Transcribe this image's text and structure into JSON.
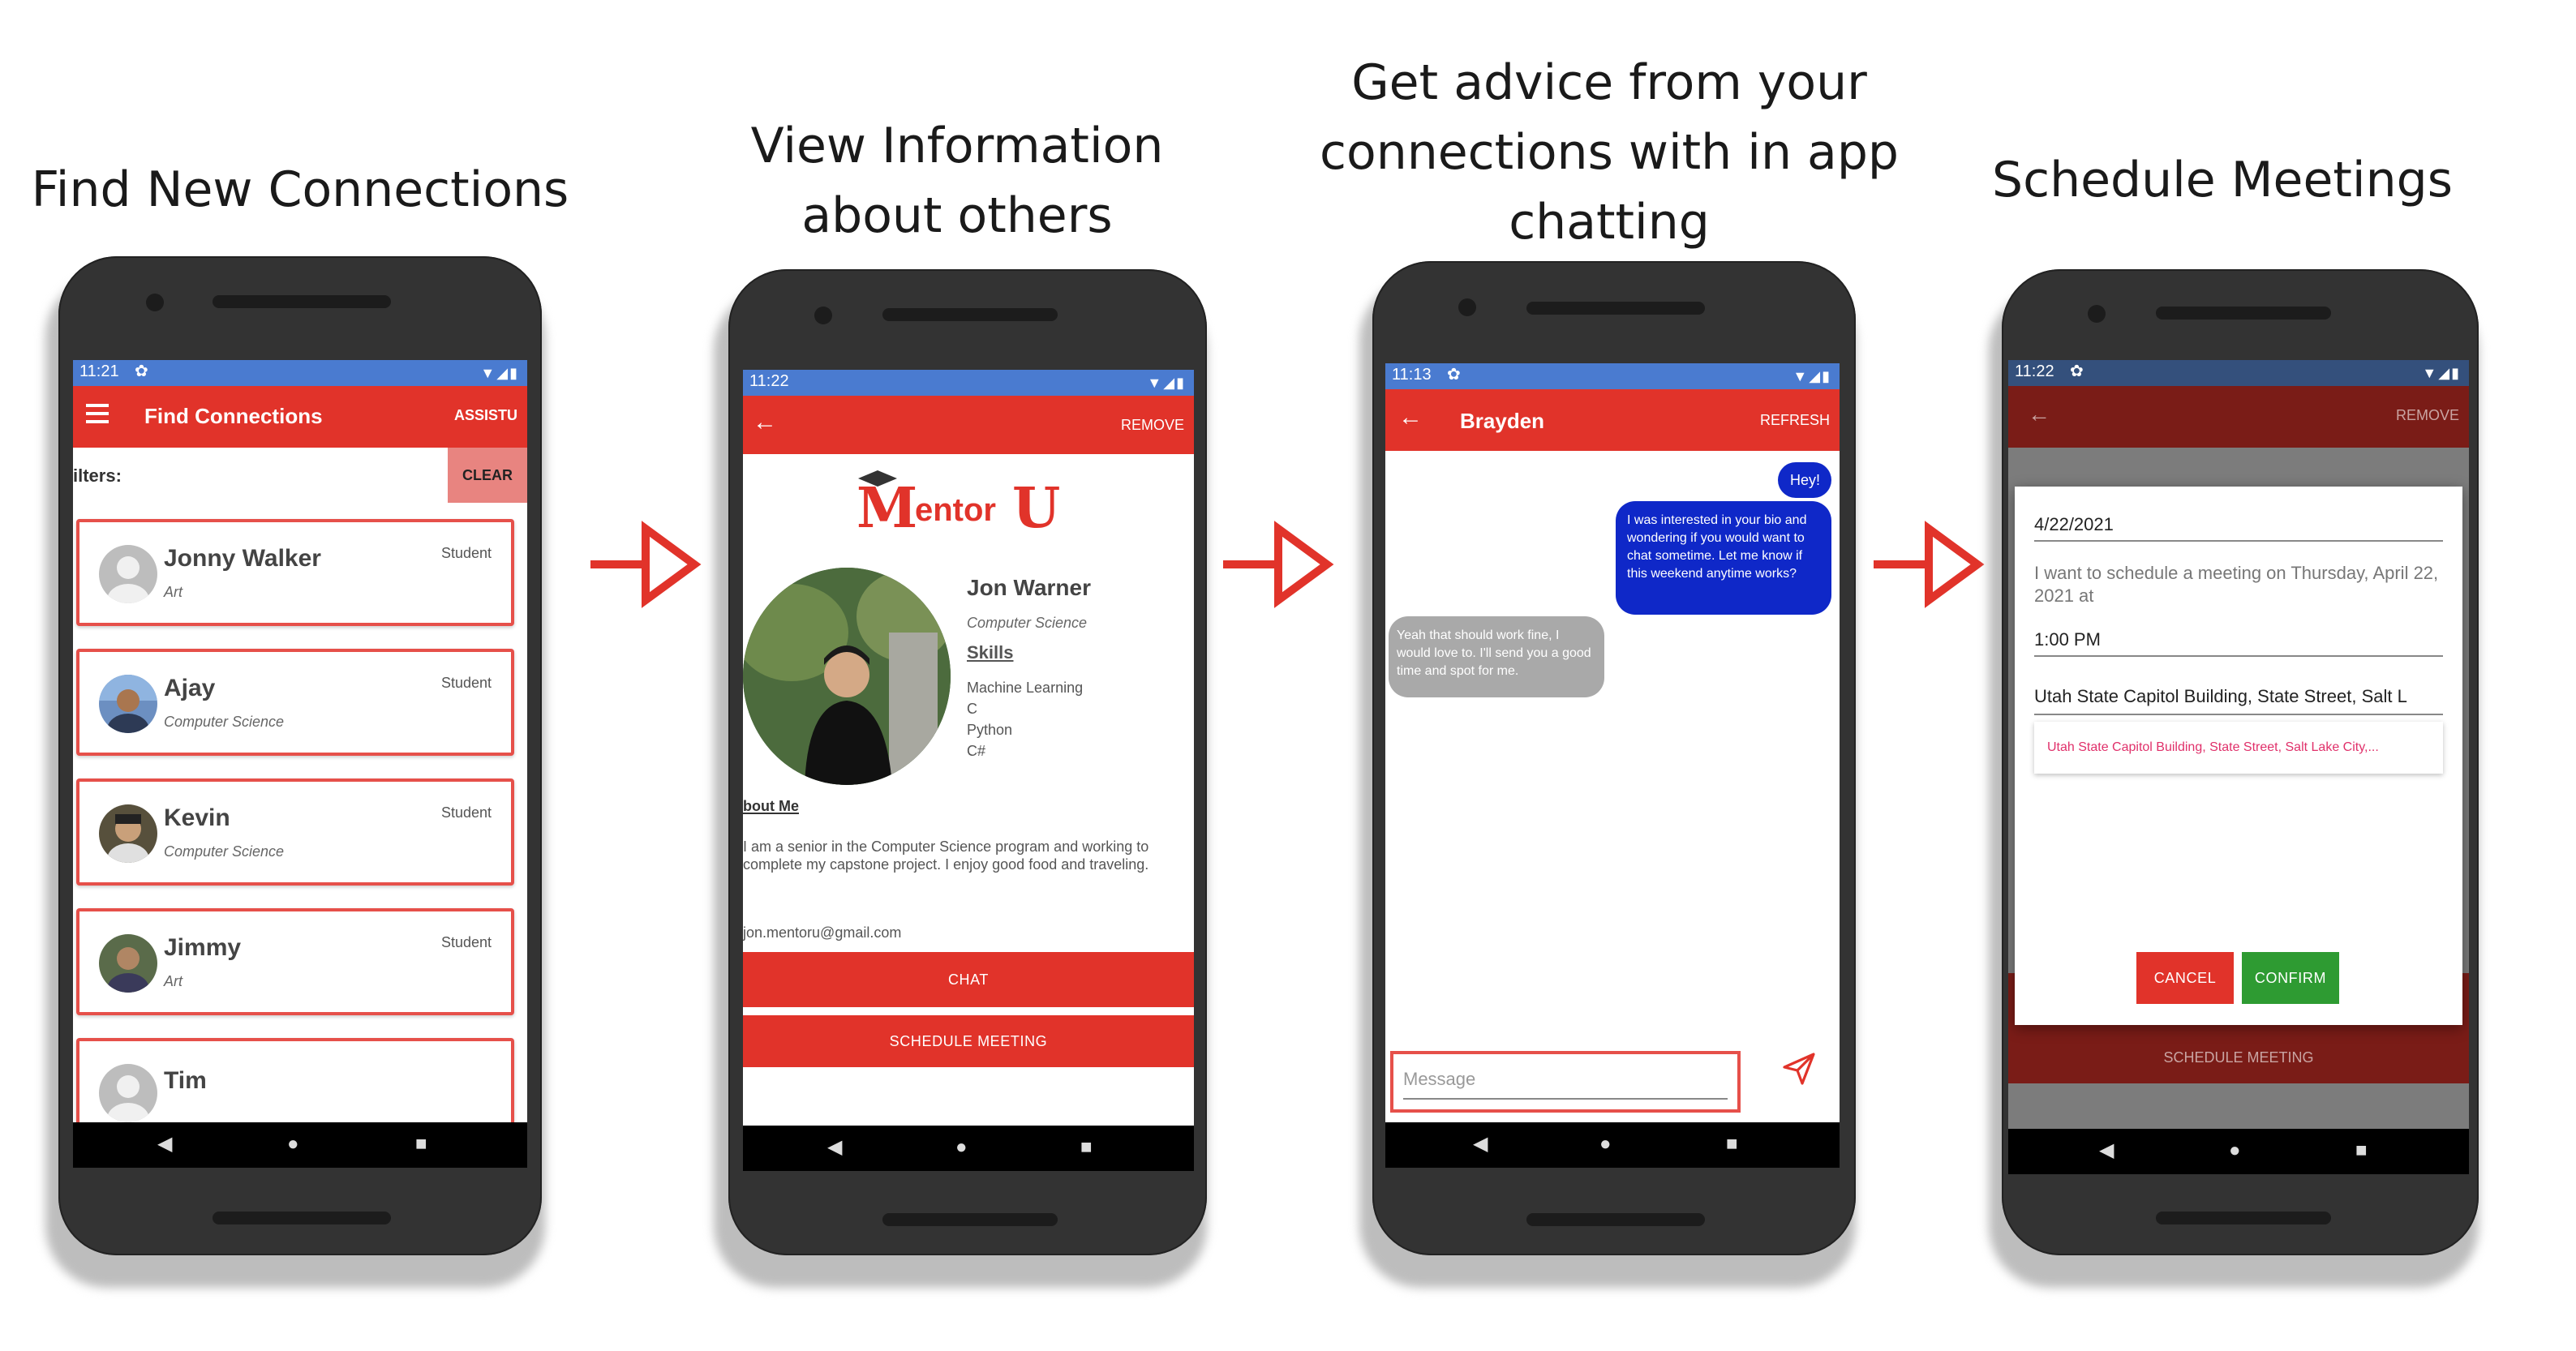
{
  "captions": {
    "step1": "Find New Connections",
    "step2_line1": "View Information",
    "step2_line2": "about others",
    "step3_line1": "Get advice from your",
    "step3_line2": "connections with in app",
    "step3_line3": "chatting",
    "step4": "Schedule Meetings"
  },
  "colors": {
    "accent": "#e1332a",
    "statusbar": "#4a7bd0",
    "sent_bubble": "#0f28c8",
    "confirm": "#2e9b32"
  },
  "phone1": {
    "time": "11:21",
    "title": "Find Connections",
    "action": "ASSISTU",
    "filters_label": "ilters:",
    "clear_label": "CLEAR",
    "people": [
      {
        "name": "Jonny Walker",
        "major": "Art",
        "role": "Student"
      },
      {
        "name": "Ajay",
        "major": "Computer Science",
        "role": "Student"
      },
      {
        "name": "Kevin",
        "major": "Computer Science",
        "role": "Student"
      },
      {
        "name": "Jimmy",
        "major": "Art",
        "role": "Student"
      },
      {
        "name": "Tim",
        "major": "",
        "role": ""
      }
    ]
  },
  "phone2": {
    "time": "11:22",
    "action": "REMOVE",
    "logo_main": "entor",
    "logo_m": "M",
    "logo_u": "U",
    "name": "Jon Warner",
    "major": "Computer Science",
    "skills_heading": "Skills",
    "skills": [
      "Machine Learning",
      "C",
      "Python",
      "C#"
    ],
    "about_heading": "bout Me",
    "about_text": "I am a senior in the Computer Science program and working to complete my capstone project. I enjoy good food and traveling.",
    "email": "jon.mentoru@gmail.com",
    "chat_label": "CHAT",
    "schedule_label": "SCHEDULE MEETING"
  },
  "phone3": {
    "time": "11:13",
    "title": "Brayden",
    "action": "REFRESH",
    "msg_hey": "Hey!",
    "msg_sent": "I was interested in your bio and wondering if you would want to chat sometime. Let me know if this weekend anytime works?",
    "msg_received": "Yeah that should work fine, I would love to. I'll send you a good time and spot for me.",
    "input_placeholder": "Message"
  },
  "phone4": {
    "time": "11:22",
    "action": "REMOVE",
    "date_value": "4/22/2021",
    "description": "I want to schedule a meeting on Thursday, April 22, 2021 at",
    "time_value": "1:00 PM",
    "location_value": "Utah State Capitol Building, State Street, Salt L",
    "suggestion": "Utah State Capitol Building, State Street, Salt Lake City,...",
    "cancel_label": "CANCEL",
    "confirm_label": "CONFIRM",
    "behind_label": "SCHEDULE MEETING"
  },
  "icons": [
    "menu-icon",
    "settings-icon",
    "wifi-icon",
    "signal-icon",
    "battery-icon",
    "back-arrow-icon",
    "send-icon",
    "nav-back-icon",
    "nav-home-icon",
    "nav-recents-icon",
    "right-arrow-icon",
    "graduation-cap-icon"
  ]
}
